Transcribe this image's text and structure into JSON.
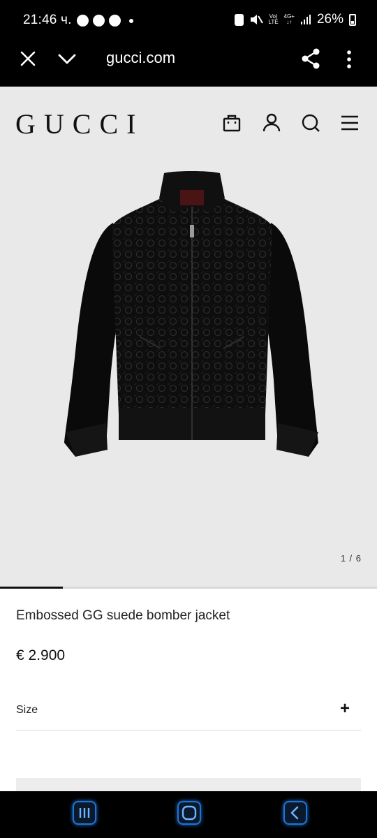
{
  "status_bar": {
    "time": "21:46 ч.",
    "network_top": "Vo)",
    "network_bottom": "LTE",
    "data_top": "4G+",
    "data_bottom": "↓↑",
    "battery": "26%"
  },
  "browser": {
    "domain": "gucci.com"
  },
  "site_header": {
    "logo": "GUCCI"
  },
  "product": {
    "image_counter": "1 / 6",
    "image_progress": 0.1667,
    "title": "Embossed GG suede bomber jacket",
    "price": "€ 2.900",
    "size_label": "Size",
    "size_expand": "+"
  },
  "colors": {
    "hero_background": "#e9e9e9",
    "jacket": "#0d0d0d",
    "nav_accent": "#1e74d6"
  },
  "icons": [
    "close-icon",
    "chevron-down-icon",
    "share-icon",
    "more-vert-icon",
    "bag-icon",
    "account-icon",
    "search-icon",
    "hamburger-menu-icon",
    "recents-icon",
    "home-icon",
    "back-icon"
  ]
}
